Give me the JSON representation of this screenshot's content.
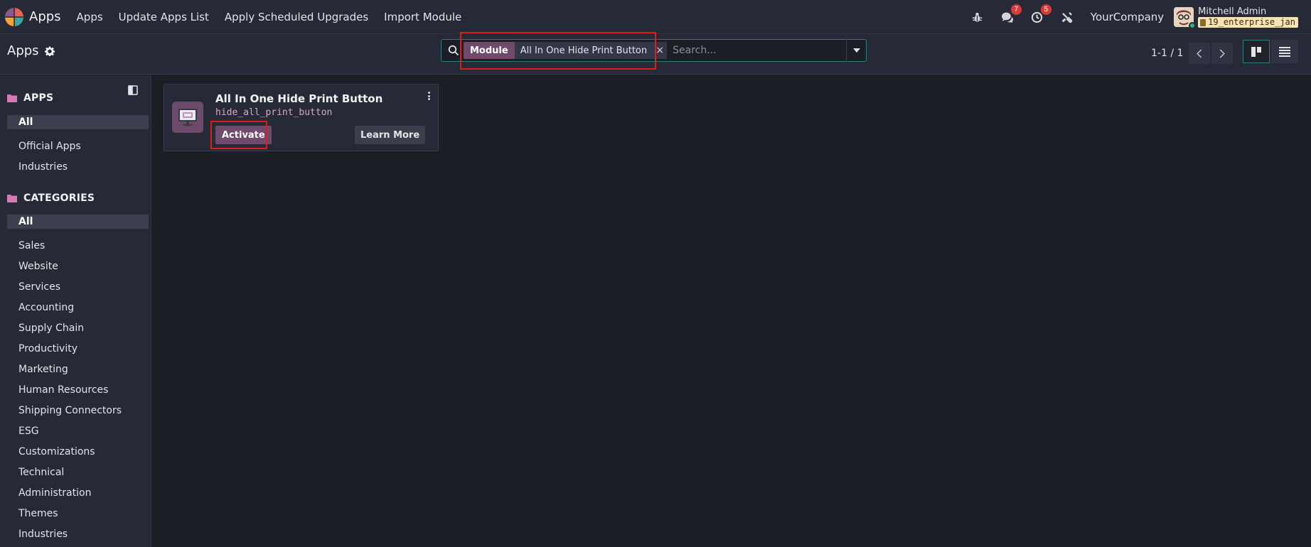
{
  "navbar": {
    "brand": "Apps",
    "menu": [
      "Apps",
      "Update Apps List",
      "Apply Scheduled Upgrades",
      "Import Module"
    ],
    "messages_count": "7",
    "activities_count": "5",
    "company": "YourCompany",
    "user_name": "Mitchell Admin",
    "database": "19_enterprise_jan"
  },
  "control_panel": {
    "title": "Apps",
    "search": {
      "facet_label": "Module",
      "facet_value": "All In One Hide Print Button",
      "facet_remove": "×",
      "placeholder": "Search..."
    },
    "pager": "1-1 / 1"
  },
  "sidebar": {
    "apps_title": "APPS",
    "apps_items": [
      "All",
      "Official Apps",
      "Industries"
    ],
    "categories_title": "CATEGORIES",
    "categories_items": [
      "All",
      "Sales",
      "Website",
      "Services",
      "Accounting",
      "Supply Chain",
      "Productivity",
      "Marketing",
      "Human Resources",
      "Shipping Connectors",
      "ESG",
      "Customizations",
      "Technical",
      "Administration",
      "Themes",
      "Industries"
    ]
  },
  "card": {
    "name": "All In One Hide Print Button",
    "technical_name": "hide_all_print_button",
    "activate_label": "Activate",
    "learn_more_label": "Learn More"
  },
  "colors": {
    "accent": "#6f4a6d",
    "teal": "#2c7d78",
    "highlight": "#e01b1b",
    "badge": "#d63a3a"
  }
}
